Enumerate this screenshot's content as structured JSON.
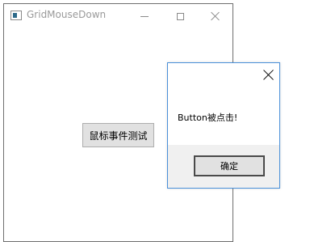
{
  "main_window": {
    "title": "GridMouseDown",
    "button_label": "鼠标事件测试"
  },
  "message_box": {
    "message": "Button被点击!",
    "ok_label": "确定"
  },
  "icons": {
    "app": "app-window-icon",
    "minimize": "minimize-icon",
    "maximize": "maximize-icon",
    "close": "close-icon"
  }
}
